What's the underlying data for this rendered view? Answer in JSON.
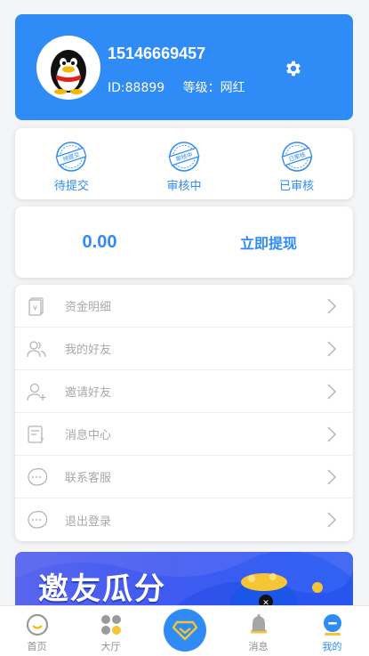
{
  "profile": {
    "phone": "15146669457",
    "id_text": "ID:88899",
    "level_text": "等级：网红",
    "settings_icon": "gear-icon",
    "accent_color": "#2f8bf6"
  },
  "status_tabs": [
    {
      "label": "待提交",
      "stamp": "待提交",
      "icon": "stamp-icon"
    },
    {
      "label": "审核中",
      "stamp": "审核中",
      "icon": "stamp-icon"
    },
    {
      "label": "已审核",
      "stamp": "已审核",
      "icon": "stamp-icon"
    }
  ],
  "balance": {
    "amount": "0.00",
    "withdraw_label": "立即提现"
  },
  "menu": [
    {
      "label": "资金明细",
      "icon": "wallet-icon"
    },
    {
      "label": "我的好友",
      "icon": "friends-icon"
    },
    {
      "label": "邀请好友",
      "icon": "add-user-icon"
    },
    {
      "label": "消息中心",
      "icon": "message-icon"
    },
    {
      "label": "联系客服",
      "icon": "chat-icon"
    },
    {
      "label": "退出登录",
      "icon": "logout-icon"
    }
  ],
  "banner": {
    "title": "邀友瓜分"
  },
  "tabbar": [
    {
      "label": "首页",
      "icon": "home-icon",
      "active": false
    },
    {
      "label": "大厅",
      "icon": "hall-icon",
      "active": false
    },
    {
      "label": "",
      "icon": "diamond-icon",
      "active": false
    },
    {
      "label": "消息",
      "icon": "bell-icon",
      "active": false
    },
    {
      "label": "我的",
      "icon": "user-icon",
      "active": true
    }
  ]
}
